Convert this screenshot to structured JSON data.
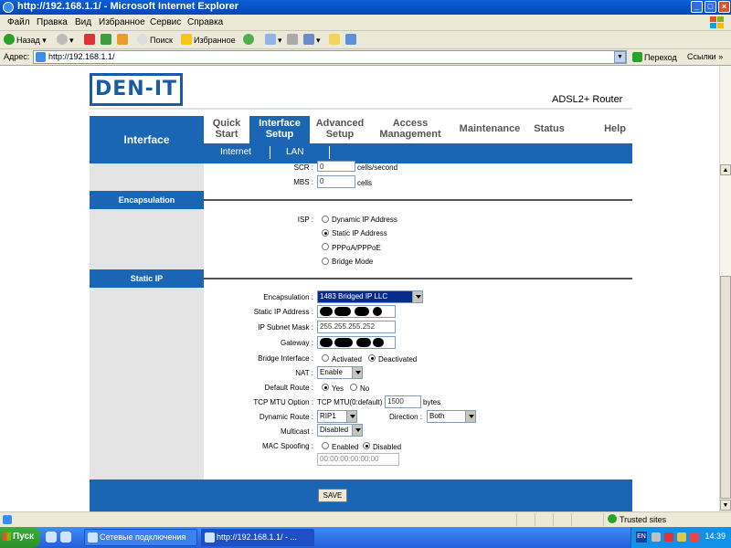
{
  "window": {
    "title": "http://192.168.1.1/ - Microsoft Internet Explorer",
    "minimize": "_",
    "maximize": "□",
    "close": "×"
  },
  "menu": [
    "Файл",
    "Правка",
    "Вид",
    "Избранное",
    "Сервис",
    "Справка"
  ],
  "toolbar": {
    "back": "Назад",
    "search": "Поиск",
    "favorites": "Избранное"
  },
  "address": {
    "label": "Адрес:",
    "url": "http://192.168.1.1/",
    "go": "Переход",
    "links": "Ссылки"
  },
  "router": {
    "logo": "DEN-IT",
    "product": "ADSL2+ Router",
    "nav_title": "Interface",
    "tabs": [
      {
        "line1": "Quick",
        "line2": "Start"
      },
      {
        "line1": "Interface",
        "line2": "Setup"
      },
      {
        "line1": "Advanced",
        "line2": "Setup"
      },
      {
        "line1": "Access",
        "line2": "Management"
      },
      {
        "line1": "Maintenance",
        "line2": ""
      },
      {
        "line1": "Status",
        "line2": ""
      },
      {
        "line1": "Help",
        "line2": ""
      }
    ],
    "subtabs": [
      "Internet",
      "LAN"
    ],
    "scr_label": "SCR :",
    "scr_value": "0",
    "scr_unit": "cells/second",
    "mbs_label": "MBS :",
    "mbs_value": "0",
    "mbs_unit": "cells",
    "encapsulation_section": "Encapsulation",
    "isp_label": "ISP :",
    "isp_options": [
      "Dynamic IP Address",
      "Static IP Address",
      "PPPoA/PPPoE",
      "Bridge Mode"
    ],
    "isp_selected": "Static IP Address",
    "static_ip_section": "Static IP",
    "fields": {
      "encapsulation_label": "Encapsulation :",
      "encapsulation_value": "1483 Bridged IP LLC",
      "static_ip_label": "Static IP Address :",
      "subnet_label": "IP Subnet Mask :",
      "subnet_value": "255.255.255.252",
      "gateway_label": "Gateway :",
      "bridge_label": "Bridge Interface :",
      "bridge_activated": "Activated",
      "bridge_deactivated": "Deactivated",
      "nat_label": "NAT :",
      "nat_value": "Enable",
      "default_route_label": "Default Route :",
      "default_route_yes": "Yes",
      "default_route_no": "No",
      "mtu_label": "TCP MTU Option :",
      "mtu_prefix": "TCP MTU(0:default)",
      "mtu_value": "1500",
      "mtu_unit": "bytes",
      "dynamic_route_label": "Dynamic Route :",
      "dynamic_route_value": "RIP1",
      "direction_label": "Direction :",
      "direction_value": "Both",
      "multicast_label": "Multicast :",
      "multicast_value": "Disabled",
      "mac_label": "MAC Spoofing :",
      "mac_enabled": "Enabled",
      "mac_disabled": "Disabled",
      "mac_value": "00:00:00:00:00:00"
    },
    "save": "SAVE"
  },
  "status": {
    "zone": "Trusted sites"
  },
  "taskbar": {
    "start": "Пуск",
    "buttons": [
      "Сетевые подключения",
      "http://192.168.1.1/ - ..."
    ],
    "lang": "EN",
    "clock": "14:39"
  }
}
